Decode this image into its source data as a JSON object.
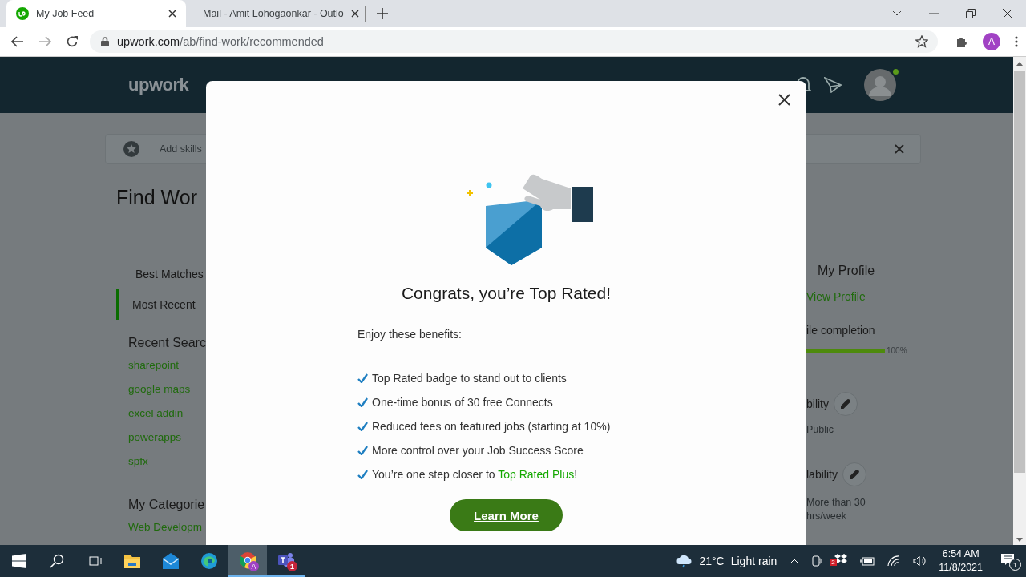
{
  "browser": {
    "tabs": [
      {
        "title": "My Job Feed",
        "kind": "upwork",
        "selected": true
      },
      {
        "title": "Mail - Amit Lohogaonkar - Outlo",
        "kind": "outlook",
        "selected": false
      }
    ],
    "url": {
      "domain": "upwork.com",
      "path": "/ab/find-work/recommended"
    },
    "profile_initial": "A"
  },
  "page": {
    "logo": "upwork",
    "skills_bar": {
      "text": "Add skills"
    },
    "heading": "Find Wor",
    "feed_tabs": [
      {
        "label": "Best Matches",
        "selected": false
      },
      {
        "label": "Most Recent",
        "selected": true
      }
    ],
    "recent_searches": {
      "title": "Recent Searc",
      "items": [
        "sharepoint",
        "google maps",
        "excel addin",
        "powerapps",
        "spfx"
      ]
    },
    "my_categories": {
      "title": "My Categorie",
      "items": [
        "Web Developm"
      ]
    },
    "profile": {
      "title": "My Profile",
      "link": "View Profile",
      "completion": {
        "label": "ile completion",
        "level": 1,
        "reading": "100%"
      },
      "visibility": {
        "label": "bility",
        "value": "Public"
      },
      "availability": {
        "label": "lability",
        "value": "More than 30",
        "value_2": "hrs/week"
      }
    }
  },
  "modal": {
    "title": "Congrats, you’re Top Rated!",
    "intro": "Enjoy these benefits:",
    "benefits": [
      {
        "text": "Top Rated badge to stand out to clients"
      },
      {
        "text": "One-time bonus of 30 free Connects"
      },
      {
        "text": "Reduced fees on featured jobs (starting at 10%)"
      },
      {
        "text": "More control over your Job Success Score"
      },
      {
        "text": "You’re one step closer to ",
        "link": "Top Rated Plus",
        "after": "!"
      }
    ],
    "button": "Learn More"
  },
  "taskbar": {
    "apps": [
      {
        "kind": "explorer",
        "running": false,
        "active": false
      },
      {
        "kind": "mail",
        "running": false,
        "active": false
      },
      {
        "kind": "edge",
        "running": false,
        "active": false
      },
      {
        "kind": "chrome",
        "running": true,
        "active": true,
        "badge": "A"
      },
      {
        "kind": "teams",
        "running": true,
        "active": false,
        "badge": "1"
      }
    ],
    "weather": {
      "temp": "21°C",
      "text": "Light rain"
    },
    "dropbox_badge": "2",
    "time": "6:54 AM",
    "date": "11/8/2021",
    "notifications": "1"
  }
}
